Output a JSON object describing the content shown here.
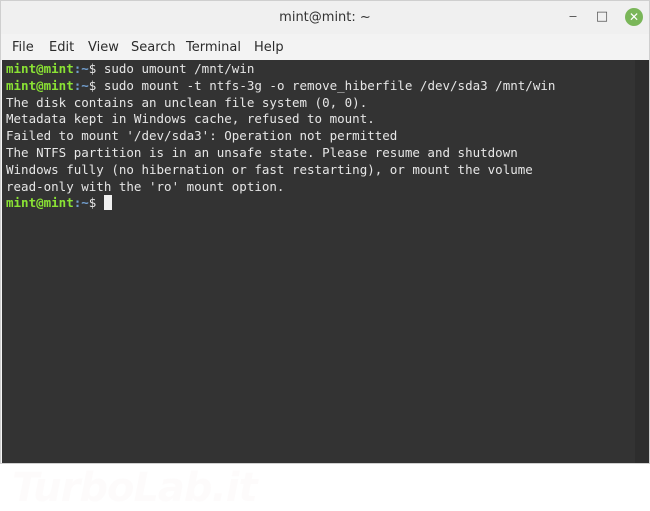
{
  "window": {
    "title": "mint@mint: ~",
    "controls": {
      "minimize": "‒",
      "maximize": "□",
      "close": "✕"
    }
  },
  "menu": [
    "File",
    "Edit",
    "View",
    "Search",
    "Terminal",
    "Help"
  ],
  "terminal": {
    "prompt_user": "mint@mint",
    "prompt_path": ":~",
    "prompt_symbol": "$",
    "lines": [
      {
        "type": "command",
        "text": " sudo umount /mnt/win"
      },
      {
        "type": "command",
        "text": " sudo mount -t ntfs-3g -o remove_hiberfile /dev/sda3 /mnt/win"
      },
      {
        "type": "output",
        "text": "The disk contains an unclean file system (0, 0)."
      },
      {
        "type": "output",
        "text": "Metadata kept in Windows cache, refused to mount."
      },
      {
        "type": "output",
        "text": "Failed to mount '/dev/sda3': Operation not permitted"
      },
      {
        "type": "output",
        "text": "The NTFS partition is in an unsafe state. Please resume and shutdown"
      },
      {
        "type": "output",
        "text": "Windows fully (no hibernation or fast restarting), or mount the volume"
      },
      {
        "type": "output",
        "text": "read-only with the 'ro' mount option."
      },
      {
        "type": "command",
        "text": " "
      }
    ]
  },
  "watermark": "TurboLab.it",
  "colors": {
    "terminal_bg": "#333333",
    "prompt_user": "#8ae234",
    "prompt_path": "#729fcf",
    "text": "#e6e6e6",
    "close_button": "#7ab659"
  }
}
